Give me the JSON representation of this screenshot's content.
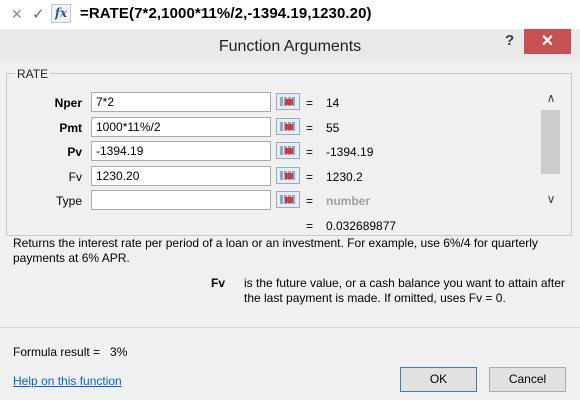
{
  "formula_bar": {
    "cancel_icon": "✕",
    "enter_icon": "✓",
    "fx_icon": "fx",
    "formula": "=RATE(7*2,1000*11%/2,-1394.19,1230.20)"
  },
  "dialog": {
    "title": "Function Arguments",
    "help_glyph": "?",
    "close_glyph": "✕",
    "function_name": "RATE",
    "args": [
      {
        "label": "Nper",
        "bold": true,
        "input": "7*2",
        "value": "14"
      },
      {
        "label": "Pmt",
        "bold": true,
        "input": "1000*11%/2",
        "value": "55"
      },
      {
        "label": "Pv",
        "bold": true,
        "input": "-1394.19",
        "value": "-1394.19"
      },
      {
        "label": "Fv",
        "bold": false,
        "input": "1230.20",
        "value": "1230.2"
      },
      {
        "label": "Type",
        "bold": false,
        "input": "",
        "value": "number"
      }
    ],
    "equals": "=",
    "result_value": "0.032689877",
    "description": "Returns the interest rate per period of a loan or an investment. For example, use 6%/4 for quarterly payments at 6% APR.",
    "arg_desc_name": "Fv",
    "arg_desc_text": "is the future value, or a cash balance you want to attain after the last payment is made. If omitted, uses Fv = 0.",
    "formula_result_label": "Formula result =",
    "formula_result_value": "3%",
    "help_link": "Help on this function",
    "ok_label": "OK",
    "cancel_label": "Cancel",
    "scroll_up": "∧",
    "scroll_down": "∨"
  },
  "colors": {
    "close_button": "#c75050",
    "link": "#0066cc",
    "dialog_bg": "#f0f0f0"
  }
}
